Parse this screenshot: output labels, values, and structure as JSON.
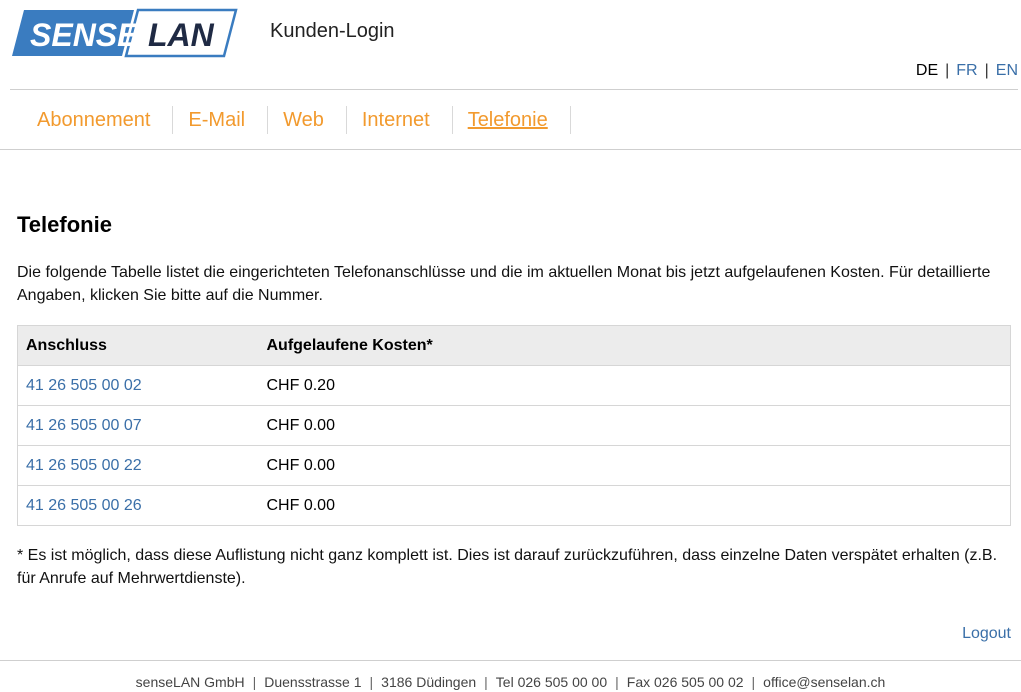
{
  "header": {
    "logo_text_left": "SENSE",
    "logo_text_right": "LAN",
    "portal_title": "Kunden-Login"
  },
  "languages": {
    "current": "DE",
    "others": [
      "FR",
      "EN"
    ],
    "separator": "|"
  },
  "nav": {
    "items": [
      {
        "label": "Abonnement"
      },
      {
        "label": "E-Mail"
      },
      {
        "label": "Web"
      },
      {
        "label": "Internet"
      },
      {
        "label": "Telefonie",
        "active": true
      }
    ]
  },
  "main": {
    "title": "Telefonie",
    "intro": "Die folgende Tabelle listet die eingerichteten Telefonanschlüsse und die im aktuellen Monat bis jetzt aufgelaufenen Kosten. Für detaillierte Angaben, klicken Sie bitte auf die Nummer.",
    "table": {
      "headers": [
        "Anschluss",
        "Aufgelaufene Kosten*"
      ],
      "rows": [
        {
          "number": "41 26 505 00 02",
          "cost": "CHF 0.20"
        },
        {
          "number": "41 26 505 00 07",
          "cost": "CHF 0.00"
        },
        {
          "number": "41 26 505 00 22",
          "cost": "CHF 0.00"
        },
        {
          "number": "41 26 505 00 26",
          "cost": "CHF 0.00"
        }
      ]
    },
    "note": "* Es ist möglich, dass diese Auflistung nicht ganz komplett ist. Dies ist darauf zurückzuführen, dass einzelne Daten verspätet erhalten (z.B. für Anrufe auf Mehrwertdienste).",
    "logout_label": "Logout"
  },
  "footer": {
    "items": [
      "senseLAN GmbH",
      "Duensstrasse 1",
      "3186 Düdingen",
      "Tel 026 505 00 00",
      "Fax 026 505 00 02",
      "office@senselan.ch"
    ],
    "separator": "|"
  },
  "colors": {
    "brand_blue": "#3a7cc0",
    "nav_orange": "#f29a2e",
    "link_blue": "#3a6fa8",
    "table_header_bg": "#ececec"
  }
}
